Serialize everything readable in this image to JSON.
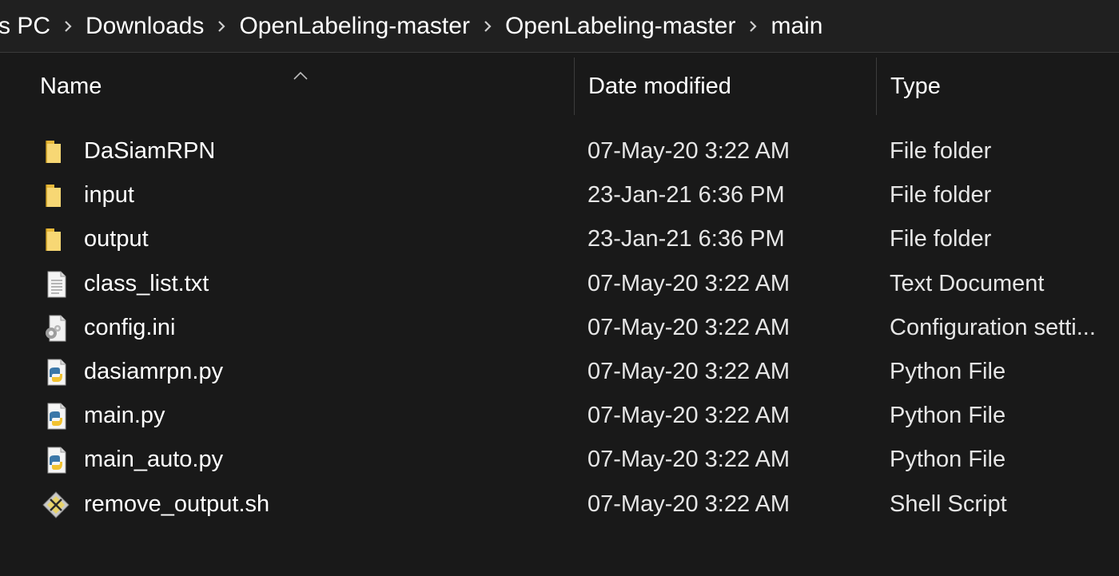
{
  "breadcrumb": {
    "items": [
      {
        "label": "s PC"
      },
      {
        "label": "Downloads"
      },
      {
        "label": "OpenLabeling-master"
      },
      {
        "label": "OpenLabeling-master"
      },
      {
        "label": "main"
      }
    ]
  },
  "columns": {
    "name": "Name",
    "date_modified": "Date modified",
    "type": "Type",
    "sort_indicator": "ascending"
  },
  "files": [
    {
      "name": "DaSiamRPN",
      "date": "07-May-20 3:22 AM",
      "type": "File folder",
      "icon": "folder-icon"
    },
    {
      "name": "input",
      "date": "23-Jan-21 6:36 PM",
      "type": "File folder",
      "icon": "folder-icon"
    },
    {
      "name": "output",
      "date": "23-Jan-21 6:36 PM",
      "type": "File folder",
      "icon": "folder-icon"
    },
    {
      "name": "class_list.txt",
      "date": "07-May-20 3:22 AM",
      "type": "Text Document",
      "icon": "text-file-icon"
    },
    {
      "name": "config.ini",
      "date": "07-May-20 3:22 AM",
      "type": "Configuration setti...",
      "icon": "config-file-icon"
    },
    {
      "name": "dasiamrpn.py",
      "date": "07-May-20 3:22 AM",
      "type": "Python File",
      "icon": "python-file-icon"
    },
    {
      "name": "main.py",
      "date": "07-May-20 3:22 AM",
      "type": "Python File",
      "icon": "python-file-icon"
    },
    {
      "name": "main_auto.py",
      "date": "07-May-20 3:22 AM",
      "type": "Python File",
      "icon": "python-file-icon"
    },
    {
      "name": "remove_output.sh",
      "date": "07-May-20 3:22 AM",
      "type": "Shell Script",
      "icon": "shell-script-icon"
    }
  ],
  "colors": {
    "background": "#191919",
    "address_bar": "#202020",
    "folder_yellow": "#f2c94c",
    "text": "#ffffff"
  }
}
